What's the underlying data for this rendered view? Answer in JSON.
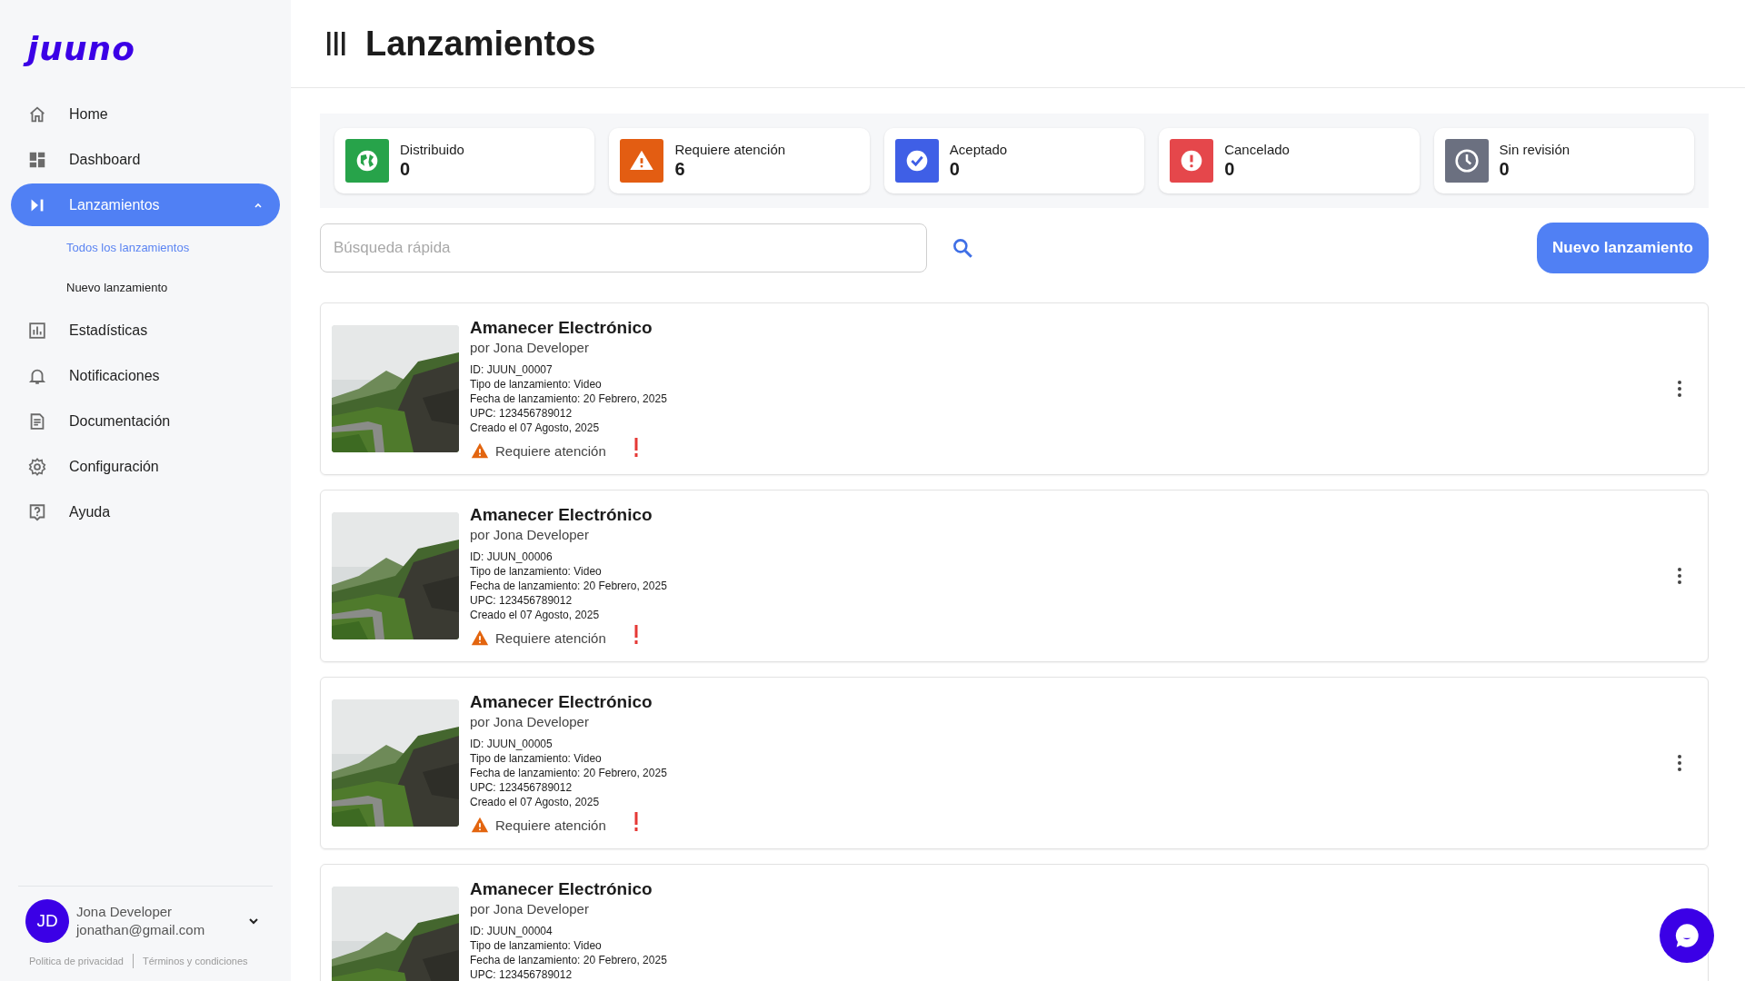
{
  "logo": "juuno",
  "sidebar": {
    "items": [
      {
        "label": "Home",
        "selected": false
      },
      {
        "label": "Dashboard",
        "selected": false
      },
      {
        "label": "Lanzamientos",
        "selected": true,
        "expanded": true,
        "children": [
          {
            "label": "Todos los lanzamientos",
            "selected": true
          },
          {
            "label": "Nuevo lanzamiento",
            "selected": false
          }
        ]
      },
      {
        "label": "Estadísticas",
        "selected": false
      },
      {
        "label": "Notificaciones",
        "selected": false
      },
      {
        "label": "Documentación",
        "selected": false
      },
      {
        "label": "Configuración",
        "selected": false
      },
      {
        "label": "Ayuda",
        "selected": false
      }
    ],
    "user": {
      "initials": "JD",
      "name": "Jona Developer",
      "email": "jonathan@gmail.com"
    },
    "footer_links": [
      "Politica de privacidad",
      "Términos y condiciones"
    ]
  },
  "page_title": "Lanzamientos",
  "stats": [
    {
      "kind": "distributed",
      "label": "Distribuido",
      "count": "0"
    },
    {
      "kind": "attention",
      "label": "Requiere atención",
      "count": "6"
    },
    {
      "kind": "accepted",
      "label": "Aceptado",
      "count": "0"
    },
    {
      "kind": "cancelled",
      "label": "Cancelado",
      "count": "0"
    },
    {
      "kind": "unreviewed",
      "label": "Sin revisión",
      "count": "0"
    }
  ],
  "search": {
    "placeholder": "Búsqueda rápida"
  },
  "new_button": "Nuevo lanzamiento",
  "releases": [
    {
      "title": "Amanecer Electrónico",
      "artist": "por Jona Developer",
      "details": [
        "ID: JUUN_00007",
        "Tipo de lanzamiento: Video",
        "Fecha de lanzamiento: 20 Febrero, 2025",
        "UPC: 123456789012",
        "Creado el 07 Agosto, 2025"
      ],
      "status": {
        "kind": "attention",
        "label": "Requiere atención"
      },
      "menu": true
    },
    {
      "title": "Amanecer Electrónico",
      "artist": "por Jona Developer",
      "details": [
        "ID: JUUN_00006",
        "Tipo de lanzamiento: Video",
        "Fecha de lanzamiento: 20 Febrero, 2025",
        "UPC: 123456789012",
        "Creado el 07 Agosto, 2025"
      ],
      "status": {
        "kind": "attention",
        "label": "Requiere atención"
      },
      "menu": true
    },
    {
      "title": "Amanecer Electrónico",
      "artist": "por Jona Developer",
      "details": [
        "ID: JUUN_00005",
        "Tipo de lanzamiento: Video",
        "Fecha de lanzamiento: 20 Febrero, 2025",
        "UPC: 123456789012",
        "Creado el 07 Agosto, 2025"
      ],
      "status": {
        "kind": "attention",
        "label": "Requiere atención"
      },
      "menu": true
    },
    {
      "title": "Amanecer Electrónico",
      "artist": "por Jona Developer",
      "details": [
        "ID: JUUN_00004",
        "Tipo de lanzamiento: Video",
        "Fecha de lanzamiento: 20 Febrero, 2025",
        "UPC: 123456789012"
      ]
    }
  ]
}
